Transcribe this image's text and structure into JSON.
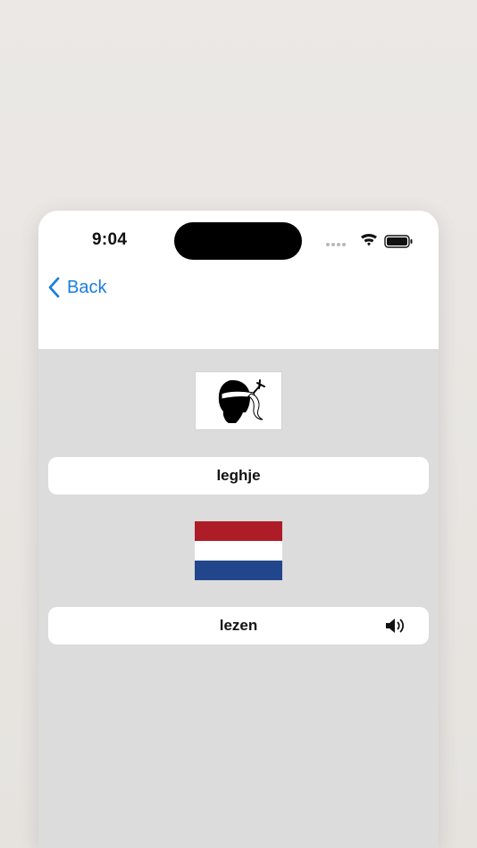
{
  "status_bar": {
    "time": "9:04"
  },
  "nav": {
    "back_label": "Back"
  },
  "cards": [
    {
      "language": "Corsican",
      "flag": "corsica-flag",
      "word": "leghje"
    },
    {
      "language": "Dutch",
      "flag": "netherlands-flag",
      "word": "lezen",
      "icon": "speaker-icon"
    }
  ],
  "colors": {
    "accent": "#1a7ee0",
    "content_bg": "#dcdcdc",
    "nl_red": "#ae1c28",
    "nl_blue": "#21468b"
  }
}
